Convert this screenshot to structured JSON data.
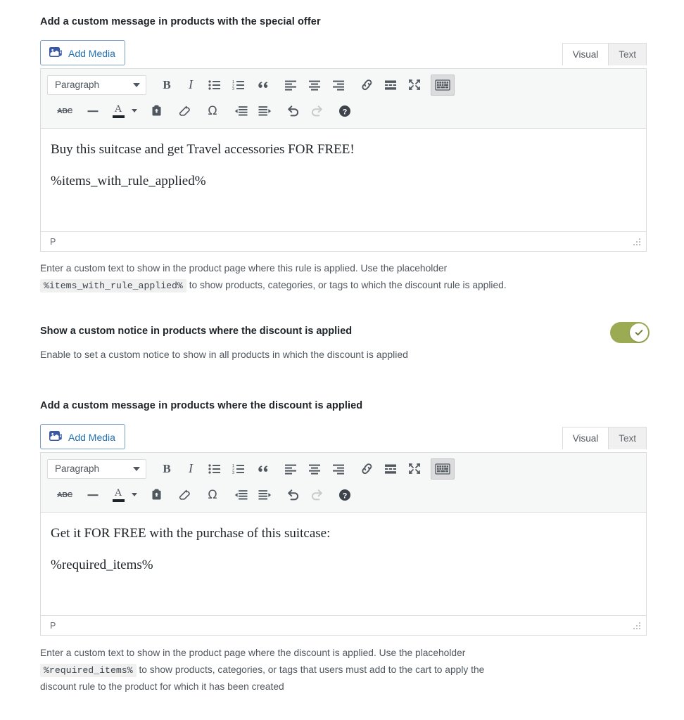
{
  "section_one": {
    "field_label": "Add a custom message in products with the special offer",
    "add_media_label": "Add Media",
    "tabs": {
      "visual": "Visual",
      "text": "Text"
    },
    "format_select": "Paragraph",
    "content": {
      "paragraph_1": "Buy this suitcase and get Travel accessories FOR FREE!",
      "paragraph_2": "%items_with_rule_applied%"
    },
    "statusbar_path": "P",
    "help": {
      "part_1": "Enter a custom text to show in the product page where this rule is applied. Use the placeholder",
      "placeholder": "%items_with_rule_applied%",
      "part_2": "to show products, categories, or tags to which the discount rule is applied."
    }
  },
  "toggle_section": {
    "label": "Show a custom notice in products where the discount is applied",
    "description": "Enable to set a custom notice to show in all products in which the discount is applied",
    "state": "on",
    "accent_color": "#9aab54"
  },
  "section_two": {
    "field_label": "Add a custom message in products where the discount is applied",
    "add_media_label": "Add Media",
    "tabs": {
      "visual": "Visual",
      "text": "Text"
    },
    "format_select": "Paragraph",
    "content": {
      "paragraph_1": "Get it FOR FREE with the purchase of this suitcase:",
      "paragraph_2": "%required_items%"
    },
    "statusbar_path": "P",
    "help": {
      "part_1": "Enter a custom text to show in the product page where the discount is applied. Use the placeholder",
      "placeholder": "%required_items%",
      "part_2": "to show products, categories, or tags that users must add to the cart to apply the",
      "part_3": "discount rule to the product for which it has been created"
    }
  },
  "toolbar": {
    "row1": [
      {
        "name": "bold",
        "label": "B"
      },
      {
        "name": "italic",
        "label": "I"
      },
      {
        "name": "bulleted-list",
        "label": ""
      },
      {
        "name": "numbered-list",
        "label": ""
      },
      {
        "name": "blockquote",
        "label": ""
      },
      {
        "name": "align-left",
        "label": ""
      },
      {
        "name": "align-center",
        "label": ""
      },
      {
        "name": "align-right",
        "label": ""
      },
      {
        "name": "insert-link",
        "label": ""
      },
      {
        "name": "read-more",
        "label": ""
      },
      {
        "name": "fullscreen",
        "label": ""
      },
      {
        "name": "toolbar-toggle",
        "label": ""
      }
    ],
    "row2": [
      {
        "name": "strikethrough",
        "label": "ABC"
      },
      {
        "name": "horizontal-line",
        "label": ""
      },
      {
        "name": "text-color",
        "label": "A"
      },
      {
        "name": "paste-as-text",
        "label": ""
      },
      {
        "name": "clear-formatting",
        "label": ""
      },
      {
        "name": "special-character",
        "label": "Ω"
      },
      {
        "name": "decrease-indent",
        "label": ""
      },
      {
        "name": "increase-indent",
        "label": ""
      },
      {
        "name": "undo",
        "label": ""
      },
      {
        "name": "redo",
        "label": ""
      },
      {
        "name": "keyboard-shortcuts-help",
        "label": "?"
      }
    ]
  }
}
